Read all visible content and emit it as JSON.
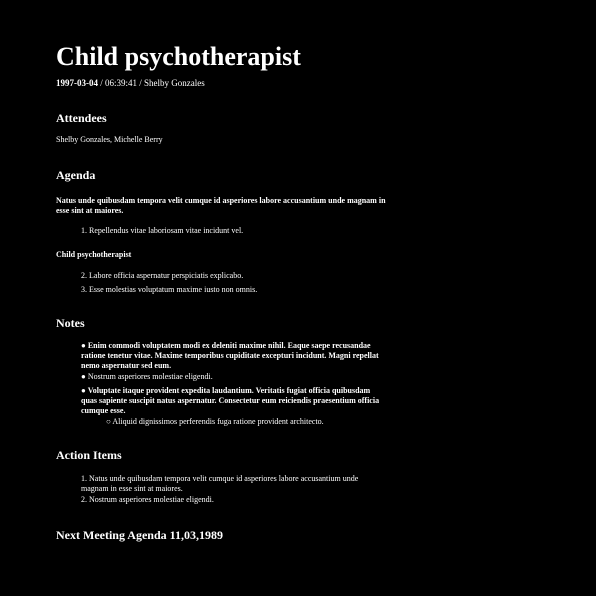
{
  "document": {
    "title": "Child psychotherapist",
    "meta": {
      "date": "1997-03-04",
      "rest": " / 06:39:41 / Shelby Gonzales"
    },
    "attendees": {
      "heading": "Attendees",
      "names": "Shelby Gonzales, Michelle Berry"
    },
    "agenda": {
      "heading": "Agenda",
      "intro": "Natus unde quibusdam tempora velit cumque id asperiores labore accusantium unde magnam in esse sint at maiores.",
      "items_first": [
        {
          "marker": "1.",
          "text": "Repellendus vitae laboriosam vitae incidunt vel."
        }
      ],
      "subheading": "Child psychotherapist",
      "items_second": [
        {
          "marker": "2.",
          "text": "Labore officia aspernatur perspiciatis explicabo."
        },
        {
          "marker": "3.",
          "text": "Esse molestias voluptatum maxime iusto non omnis."
        }
      ]
    },
    "notes": {
      "heading": "Notes",
      "bullet": "●",
      "sub_bullet": "○",
      "items": [
        {
          "text": "Enim commodi voluptatem modi ex deleniti maxime nihil. Eaque saepe recusandae ratione tenetur vitae. Maxime temporibus cupiditate excepturi incidunt. Magni repellat nemo aspernatur sed eum.",
          "bold": true
        },
        {
          "text": "Nostrum asperiores molestiae eligendi.",
          "bold": false
        },
        {
          "text": "Voluptate itaque provident expedita laudantium. Veritatis fugiat officia quibusdam quas sapiente suscipit natus aspernatur. Consectetur eum reiciendis praesentium officia cumque esse.",
          "bold": true
        }
      ],
      "sub_items": [
        {
          "text": "Aliquid dignissimos perferendis fuga ratione provident architecto."
        }
      ]
    },
    "action_items": {
      "heading": "Action Items",
      "items": [
        {
          "marker": "1.",
          "text": "Natus unde quibusdam tempora velit cumque id asperiores labore accusantium unde magnam in esse sint at maiores."
        },
        {
          "marker": "2.",
          "text": "Nostrum asperiores molestiae eligendi."
        }
      ]
    },
    "next_meeting": {
      "heading": "Next Meeting Agenda 11,03,1989"
    }
  }
}
